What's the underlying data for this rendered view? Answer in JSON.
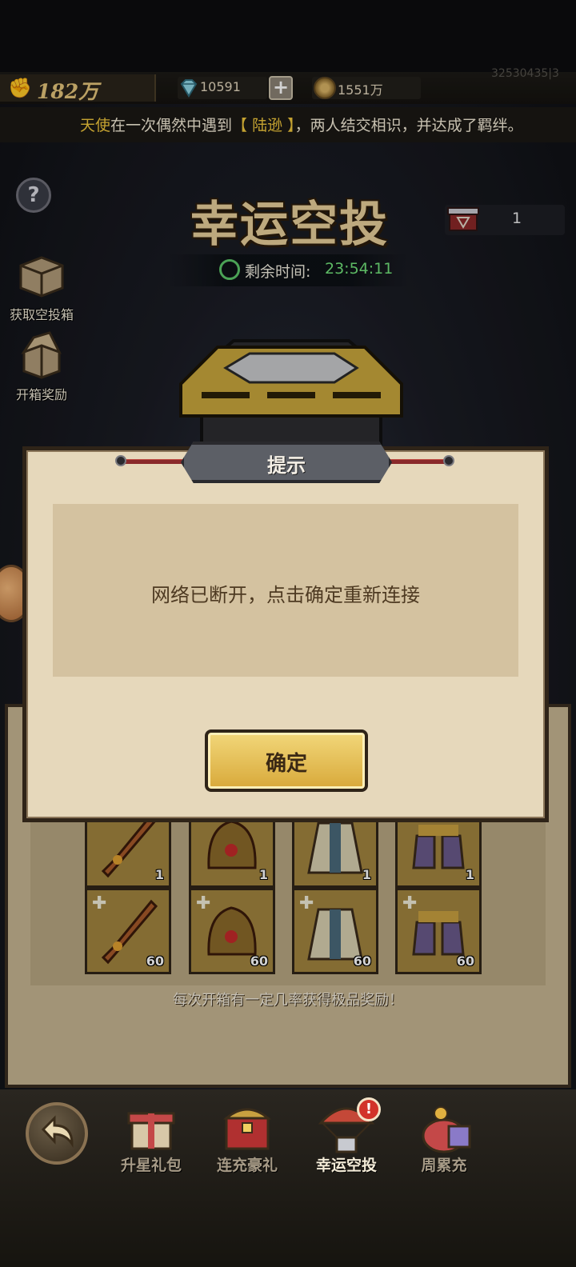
{
  "resources": {
    "power": "182万",
    "gems": "10591",
    "coins": "1551万",
    "uid": "32530435|3",
    "plus_label": "+"
  },
  "marquee": {
    "part1": "天使",
    "part2": "在一次偶然中遇到",
    "part3": "【 陆逊 】",
    "part4": "，两人结交相识，并达成了羁绊。"
  },
  "event": {
    "title": "幸运空投",
    "help_label": "?",
    "box_count": "1",
    "timer_label": "剩余时间:",
    "timer_value": "23:54:11"
  },
  "side_buttons": [
    {
      "label": "获取空投箱",
      "icon": "crate-icon"
    },
    {
      "label": "开箱奖励",
      "icon": "open-crate-icon"
    }
  ],
  "rewards": {
    "row1": [
      {
        "item": "flaming-sword",
        "count": "1"
      },
      {
        "item": "dragon-helmet",
        "count": "1"
      },
      {
        "item": "robe-armor",
        "count": "1"
      },
      {
        "item": "boots",
        "count": "1"
      }
    ],
    "row2": [
      {
        "item": "flaming-sword",
        "count": "60"
      },
      {
        "item": "dragon-helmet",
        "count": "60"
      },
      {
        "item": "robe-armor",
        "count": "60"
      },
      {
        "item": "boots",
        "count": "60"
      }
    ],
    "note": "每次开箱有一定几率获得极品奖励！"
  },
  "modal": {
    "title": "提示",
    "message": "网络已断开，点击确定重新连接",
    "confirm_label": "确定"
  },
  "bottom_nav": {
    "items": [
      {
        "label": "升星礼包",
        "icon": "gift-box-icon",
        "active": false
      },
      {
        "label": "连充豪礼",
        "icon": "treasure-chest-icon",
        "active": false
      },
      {
        "label": "幸运空投",
        "icon": "parachute-icon",
        "active": true
      },
      {
        "label": "周累充",
        "icon": "gift-bag-icon",
        "active": false
      }
    ],
    "badge": "!"
  },
  "colors": {
    "accent_gold": "#e7cf9a",
    "timer_green": "#72e27a",
    "highlight_yellow": "#f0c63c",
    "badge_red": "#d2332a"
  }
}
